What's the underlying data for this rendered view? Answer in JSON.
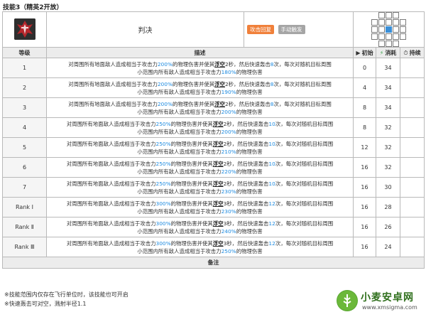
{
  "page_title": "技能3（精英2开放）",
  "skill": {
    "name": "判决",
    "tags": [
      "攻击回复",
      "手动触发"
    ],
    "icon": "crimson-skill-icon",
    "range_grid": [
      [
        0,
        1,
        1,
        1,
        0
      ],
      [
        1,
        1,
        1,
        1,
        1
      ],
      [
        1,
        1,
        2,
        1,
        1
      ],
      [
        1,
        1,
        1,
        1,
        1
      ],
      [
        0,
        1,
        1,
        1,
        0
      ]
    ]
  },
  "columns": {
    "level": "等级",
    "description": "描述",
    "initial": "初始",
    "cost": "消耗",
    "duration": "持续",
    "initial_icon": "▶",
    "cost_icon": "⚡",
    "duration_icon": "⏱"
  },
  "levels": [
    {
      "level": "1",
      "line1": {
        "pre": "对周围所有地面敌人造成相当于攻击力",
        "p1": "200%",
        "mid": "的物理伤害并使其",
        "kw": "浮空",
        "dur": "2",
        "post": "秒，然后快速轰击",
        "hits": "8",
        "tail": "次，每次对随机目标周围"
      },
      "line2": {
        "pre": "小范围内所有敌人造成相当于攻击力",
        "p2": "180%",
        "post": "的物理伤害"
      },
      "initial": "0",
      "cost": "34",
      "duration": ""
    },
    {
      "level": "2",
      "line1": {
        "pre": "对周围所有地面敌人造成相当于攻击力",
        "p1": "200%",
        "mid": "的物理伤害并使其",
        "kw": "浮空",
        "dur": "2",
        "post": "秒，然后快速轰击",
        "hits": "8",
        "tail": "次，每次对随机目标周围"
      },
      "line2": {
        "pre": "小范围内所有敌人造成相当于攻击力",
        "p2": "190%",
        "post": "的物理伤害"
      },
      "initial": "4",
      "cost": "34",
      "duration": ""
    },
    {
      "level": "3",
      "line1": {
        "pre": "对周围所有地面敌人造成相当于攻击力",
        "p1": "200%",
        "mid": "的物理伤害并使其",
        "kw": "浮空",
        "dur": "2",
        "post": "秒，然后快速轰击",
        "hits": "8",
        "tail": "次，每次对随机目标周围"
      },
      "line2": {
        "pre": "小范围内所有敌人造成相当于攻击力",
        "p2": "200%",
        "post": "的物理伤害"
      },
      "initial": "8",
      "cost": "34",
      "duration": ""
    },
    {
      "level": "4",
      "line1": {
        "pre": "对周围所有地面敌人造成相当于攻击力",
        "p1": "250%",
        "mid": "的物理伤害并使其",
        "kw": "浮空",
        "dur": "2",
        "post": "秒，然后快速轰击",
        "hits": "10",
        "tail": "次，每次对随机目标周围"
      },
      "line2": {
        "pre": "小范围内所有敌人造成相当于攻击力",
        "p2": "200%",
        "post": "的物理伤害"
      },
      "initial": "8",
      "cost": "32",
      "duration": ""
    },
    {
      "level": "5",
      "line1": {
        "pre": "对周围所有地面敌人造成相当于攻击力",
        "p1": "250%",
        "mid": "的物理伤害并使其",
        "kw": "浮空",
        "dur": "2",
        "post": "秒，然后快速轰击",
        "hits": "10",
        "tail": "次，每次对随机目标周围"
      },
      "line2": {
        "pre": "小范围内所有敌人造成相当于攻击力",
        "p2": "210%",
        "post": "的物理伤害"
      },
      "initial": "12",
      "cost": "32",
      "duration": ""
    },
    {
      "level": "6",
      "line1": {
        "pre": "对周围所有地面敌人造成相当于攻击力",
        "p1": "250%",
        "mid": "的物理伤害并使其",
        "kw": "浮空",
        "dur": "2",
        "post": "秒，然后快速轰击",
        "hits": "10",
        "tail": "次，每次对随机目标周围"
      },
      "line2": {
        "pre": "小范围内所有敌人造成相当于攻击力",
        "p2": "220%",
        "post": "的物理伤害"
      },
      "initial": "16",
      "cost": "32",
      "duration": ""
    },
    {
      "level": "7",
      "line1": {
        "pre": "对周围所有地面敌人造成相当于攻击力",
        "p1": "250%",
        "mid": "的物理伤害并使其",
        "kw": "浮空",
        "dur": "2",
        "post": "秒，然后快速轰击",
        "hits": "10",
        "tail": "次，每次对随机目标周围"
      },
      "line2": {
        "pre": "小范围内所有敌人造成相当于攻击力",
        "p2": "230%",
        "post": "的物理伤害"
      },
      "initial": "16",
      "cost": "30",
      "duration": ""
    },
    {
      "level": "Rank Ⅰ",
      "line1": {
        "pre": "对周围所有地面敌人造成相当于攻击力",
        "p1": "300%",
        "mid": "的物理伤害并使其",
        "kw": "浮空",
        "dur": "3",
        "post": "秒，然后快速轰击",
        "hits": "12",
        "tail": "次，每次对随机目标周围"
      },
      "line2": {
        "pre": "小范围内所有敌人造成相当于攻击力",
        "p2": "230%",
        "post": "的物理伤害"
      },
      "initial": "16",
      "cost": "28",
      "duration": ""
    },
    {
      "level": "Rank Ⅱ",
      "line1": {
        "pre": "对周围所有地面敌人造成相当于攻击力",
        "p1": "300%",
        "mid": "的物理伤害并使其",
        "kw": "浮空",
        "dur": "3",
        "post": "秒，然后快速轰击",
        "hits": "12",
        "tail": "次，每次对随机目标周围"
      },
      "line2": {
        "pre": "小范围内所有敌人造成相当于攻击力",
        "p2": "240%",
        "post": "的物理伤害"
      },
      "initial": "16",
      "cost": "26",
      "duration": ""
    },
    {
      "level": "Rank Ⅲ",
      "line1": {
        "pre": "对周围所有地面敌人造成相当于攻击力",
        "p1": "300%",
        "mid": "的物理伤害并使其",
        "kw": "浮空",
        "dur": "3",
        "post": "秒，然后快速轰击",
        "hits": "12",
        "tail": "次，每次对随机目标周围"
      },
      "line2": {
        "pre": "小范围内所有敌人造成相当于攻击力",
        "p2": "250%",
        "post": "的物理伤害"
      },
      "initial": "16",
      "cost": "24",
      "duration": ""
    }
  ],
  "notes_header": "备注",
  "notes": [
    "※技能范围内仅存在飞行单位时，该技能也可开启",
    "※快速轰击可对空，溅射半径1.1"
  ],
  "watermark": {
    "title": "小麦安卓网",
    "url": "www.xmsigma.com"
  }
}
